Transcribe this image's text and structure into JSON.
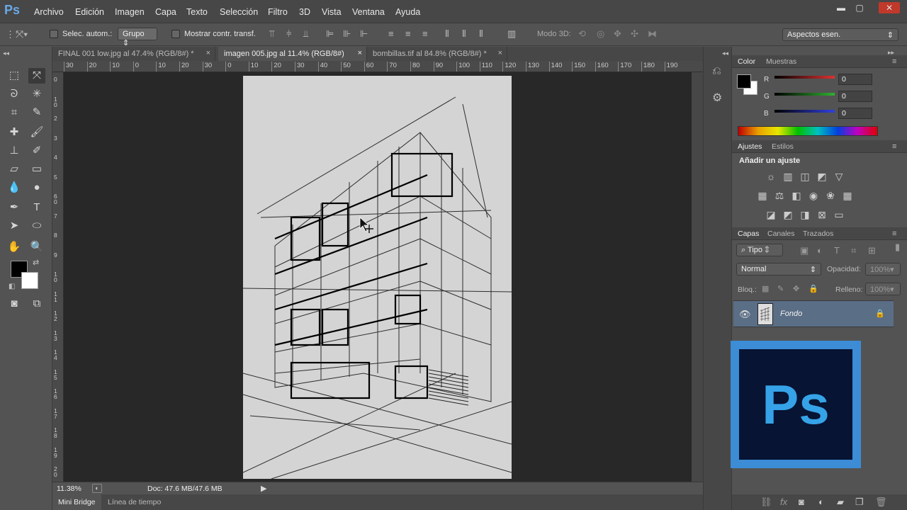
{
  "app": {
    "logo": "Ps"
  },
  "menu": [
    "Archivo",
    "Edición",
    "Imagen",
    "Capa",
    "Texto",
    "Selección",
    "Filtro",
    "3D",
    "Vista",
    "Ventana",
    "Ayuda"
  ],
  "window_controls": {
    "minimize": "▬",
    "restore": "▢",
    "close": "✕"
  },
  "options": {
    "auto_select_label": "Selec. autom.:",
    "group_value": "Grupo",
    "show_transform_label": "Mostrar contr. transf.",
    "mode3d_label": "Modo 3D:",
    "workspace_value": "Aspectos esen."
  },
  "doc_tabs": [
    {
      "label": "FINAL 001 low.jpg al 47.4% (RGB/8#) *",
      "close": "×"
    },
    {
      "label": "imagen 005.jpg al 11.4% (RGB/8#)",
      "close": "×"
    },
    {
      "label": "bombillas.tif al 84.8% (RGB/8#) *",
      "close": "×"
    }
  ],
  "ruler_top": [
    "30",
    "20",
    "10",
    "0",
    "10",
    "20",
    "30",
    "0",
    "10",
    "20",
    "30",
    "40",
    "50",
    "60",
    "70",
    "80",
    "90",
    "100",
    "110",
    "120",
    "130",
    "140",
    "150",
    "160",
    "170",
    "180",
    "190"
  ],
  "ruler_left": [
    "0",
    "1 0",
    "2",
    "3",
    "4",
    "5",
    "6 0",
    "7",
    "8",
    "9",
    "1 0",
    "1 1",
    "1 2",
    "1 3",
    "1 4",
    "1 5",
    "1 6",
    "1 7",
    "1 8",
    "1 9",
    "2 0"
  ],
  "status": {
    "zoom": "11.38%",
    "doc": "Doc: 47.6 MB/47.6 MB"
  },
  "bottom_tabs": [
    "Mini Bridge",
    "Línea de tiempo"
  ],
  "color_panel": {
    "tabs": [
      "Color",
      "Muestras"
    ],
    "channels": [
      {
        "label": "R",
        "value": "0",
        "color": "#e03030"
      },
      {
        "label": "G",
        "value": "0",
        "color": "#30b030"
      },
      {
        "label": "B",
        "value": "0",
        "color": "#3040e0"
      }
    ]
  },
  "adjust_panel": {
    "tabs": [
      "Ajustes",
      "Estilos"
    ],
    "title": "Añadir un ajuste"
  },
  "layers_panel": {
    "tabs": [
      "Capas",
      "Canales",
      "Trazados"
    ],
    "filter_label": "Tipo",
    "blend_mode": "Normal",
    "opacity_label": "Opacidad:",
    "opacity_value": "100%",
    "lock_label": "Bloq.:",
    "fill_label": "Relleno:",
    "fill_value": "100%",
    "layers": [
      {
        "name": "Fondo"
      }
    ]
  },
  "badge": {
    "text": "Ps"
  }
}
